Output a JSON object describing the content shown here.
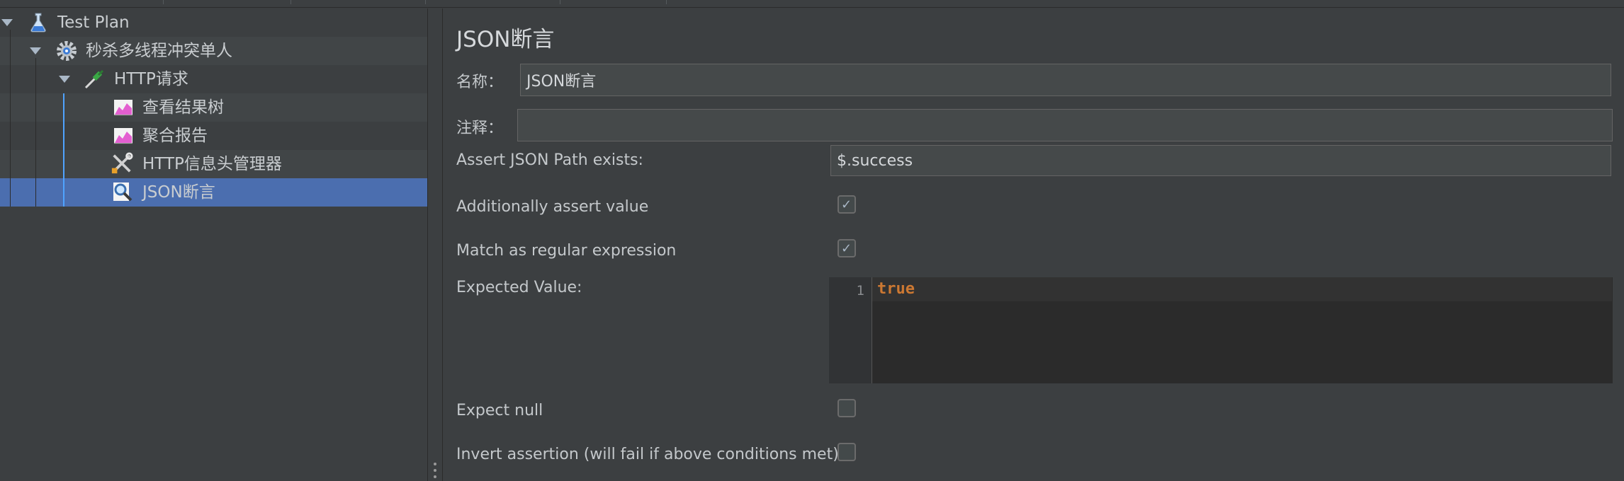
{
  "tree": {
    "items": [
      {
        "label": "Test Plan",
        "icon": "flask-icon"
      },
      {
        "label": "秒杀多线程冲突单人",
        "icon": "gear-icon"
      },
      {
        "label": "HTTP请求",
        "icon": "pipette-icon"
      },
      {
        "label": "查看结果树",
        "icon": "graph-icon"
      },
      {
        "label": "聚合报告",
        "icon": "graph-icon"
      },
      {
        "label": "HTTP信息头管理器",
        "icon": "wrench-icon"
      },
      {
        "label": "JSON断言",
        "icon": "magnifier-icon"
      }
    ],
    "selected": "JSON断言"
  },
  "form": {
    "title": "JSON断言",
    "name_label": "名称：",
    "name_value": "JSON断言",
    "comment_label": "注释：",
    "comment_value": "",
    "path_label": "Assert JSON Path exists:",
    "path_value": "$.success",
    "assert_value_label": "Additionally assert value",
    "assert_value_checked": true,
    "regex_label": "Match as regular expression",
    "regex_checked": true,
    "expected_label": "Expected Value:",
    "editor_line_number": "1",
    "editor_code": "true",
    "expect_null_label": "Expect null",
    "expect_null_checked": false,
    "invert_label": "Invert assertion (will fail if above conditions met)",
    "invert_checked": false
  },
  "colors": {
    "background": "#3c3f41",
    "selection": "#4b6eaf",
    "keyword": "#cc7832",
    "tree_guide_active": "#4fa3ff"
  }
}
